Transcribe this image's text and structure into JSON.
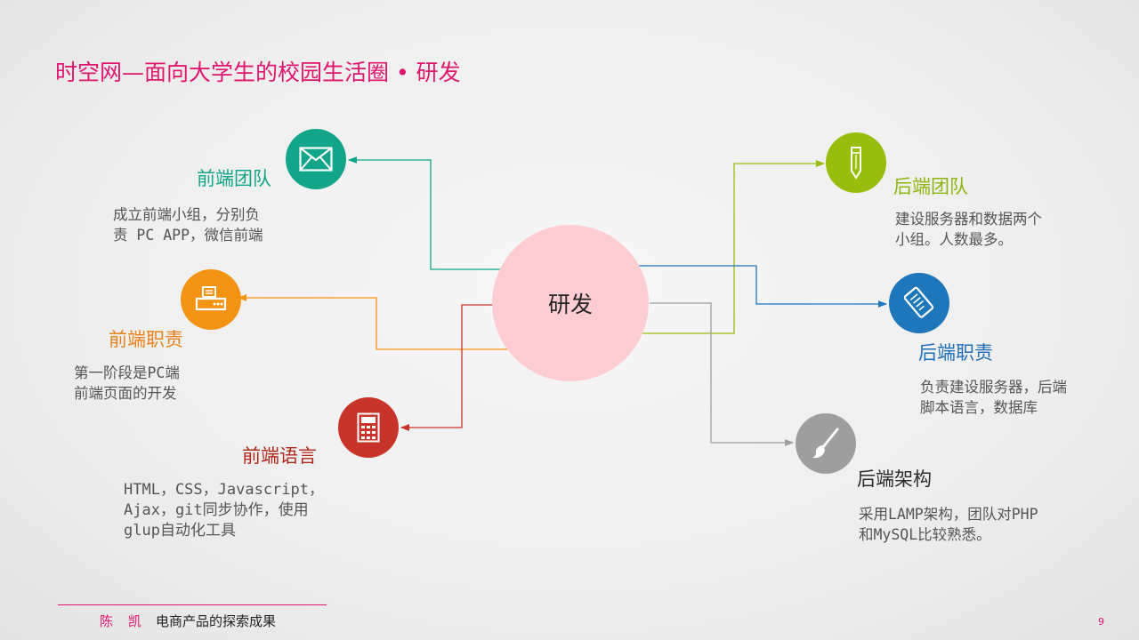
{
  "title": "时空网—面向大学生的校园生活圈 • 研发",
  "center": {
    "label": "研发",
    "color": "#fdcdd1"
  },
  "nodes": [
    {
      "id": "frontend-team",
      "icon": "envelope-icon",
      "color": "#13a589",
      "label": "前端团队",
      "desc": [
        "成立前端小组，分别负",
        "责 PC APP，微信前端"
      ]
    },
    {
      "id": "frontend-duty",
      "icon": "printer-icon",
      "color": "#f39314",
      "label": "前端职责",
      "desc": [
        "第一阶段是PC端",
        "前端页面的开发"
      ]
    },
    {
      "id": "frontend-lang",
      "icon": "calculator-icon",
      "color": "#c9342a",
      "label": "前端语言",
      "desc": [
        "HTML，CSS，Javascript，",
        "Ajax，git同步协作，使用",
        "glup自动化工具"
      ]
    },
    {
      "id": "backend-team",
      "icon": "pencil-icon",
      "color": "#97be0d",
      "label": "后端团队",
      "desc": [
        "建设服务器和数据两个",
        "小组。人数最多。"
      ]
    },
    {
      "id": "backend-duty",
      "icon": "document-icon",
      "color": "#1e76bb",
      "label": "后端职责",
      "desc": [
        "负责建设服务器，后端",
        "脚本语言，数据库"
      ]
    },
    {
      "id": "backend-arch",
      "icon": "brush-icon",
      "color": "#9e9e9e",
      "label": "后端架构",
      "desc": [
        "采用LAMP架构，团队对PHP",
        "和MySQL比较熟悉。"
      ]
    }
  ],
  "footer": {
    "name": "陈 凯",
    "subtitle": "电商产品的探索成果",
    "page": "9"
  }
}
